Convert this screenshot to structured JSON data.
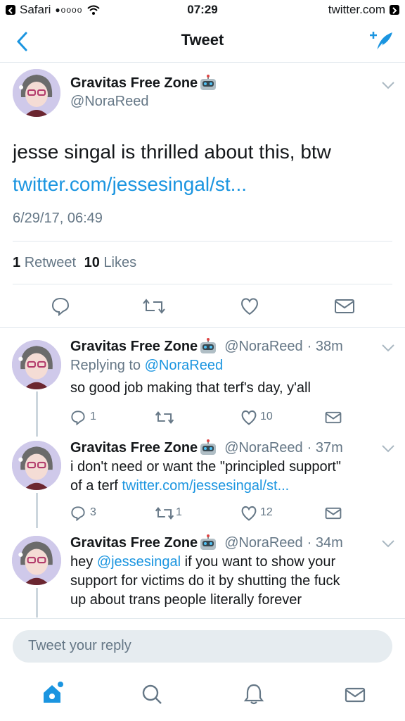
{
  "status_bar": {
    "back_app": "Safari",
    "signal": "●oooo",
    "time": "07:29",
    "domain": "twitter.com"
  },
  "nav": {
    "title": "Tweet"
  },
  "main_tweet": {
    "name": "Gravitas Free Zone",
    "handle": "@NoraReed",
    "text": "jesse singal is thrilled about this, btw",
    "link": "twitter.com/jessesingal/st...",
    "timestamp": "6/29/17, 06:49",
    "retweets_count": "1",
    "retweets_label": "Retweet",
    "likes_count": "10",
    "likes_label": "Likes"
  },
  "replies": [
    {
      "name": "Gravitas Free Zone",
      "handle": "@NoraReed",
      "time": "· 38m",
      "replying_prefix": "Replying to",
      "replying_to": "@NoraReed",
      "text": "so good job making that terf's day, y'all",
      "reply_count": "1",
      "retweet_count": "",
      "like_count": "10"
    },
    {
      "name": "Gravitas Free Zone",
      "handle": "@NoraReed",
      "time": "· 37m",
      "text_line1": "i don't need or want the \"principled support\"",
      "text_line2_prefix": "of a terf",
      "text_link": "twitter.com/jessesingal/st...",
      "reply_count": "3",
      "retweet_count": "1",
      "like_count": "12"
    },
    {
      "name": "Gravitas Free Zone",
      "handle": "@NoraReed",
      "time": "· 34m",
      "text_prefix": "hey",
      "text_mention": "@jessesingal",
      "text_line1_rest": "if you want to show your",
      "text_line2": "support for victims do it by shutting the fuck",
      "text_line3": "up about trans people literally forever"
    }
  ],
  "reply_box": {
    "placeholder": "Tweet your reply"
  },
  "colors": {
    "accent": "#1b95e0",
    "muted": "#657786",
    "border": "#e1e8ed"
  }
}
